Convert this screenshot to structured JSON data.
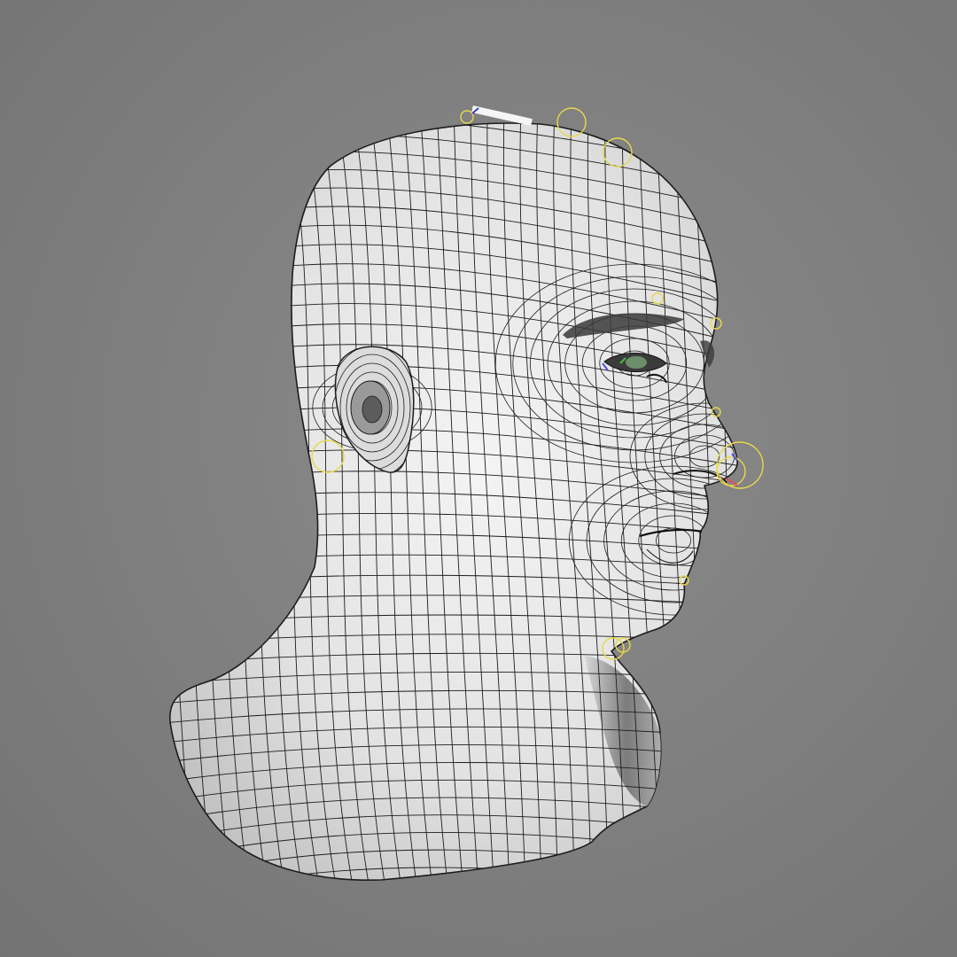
{
  "scene": {
    "background_color": "#7e7e7e",
    "mesh_fill_color": "#ececec",
    "wire_color": "#1c1c1c",
    "rig_handle_color": "#e8d84a",
    "subject": "wireframe-head-bust"
  }
}
